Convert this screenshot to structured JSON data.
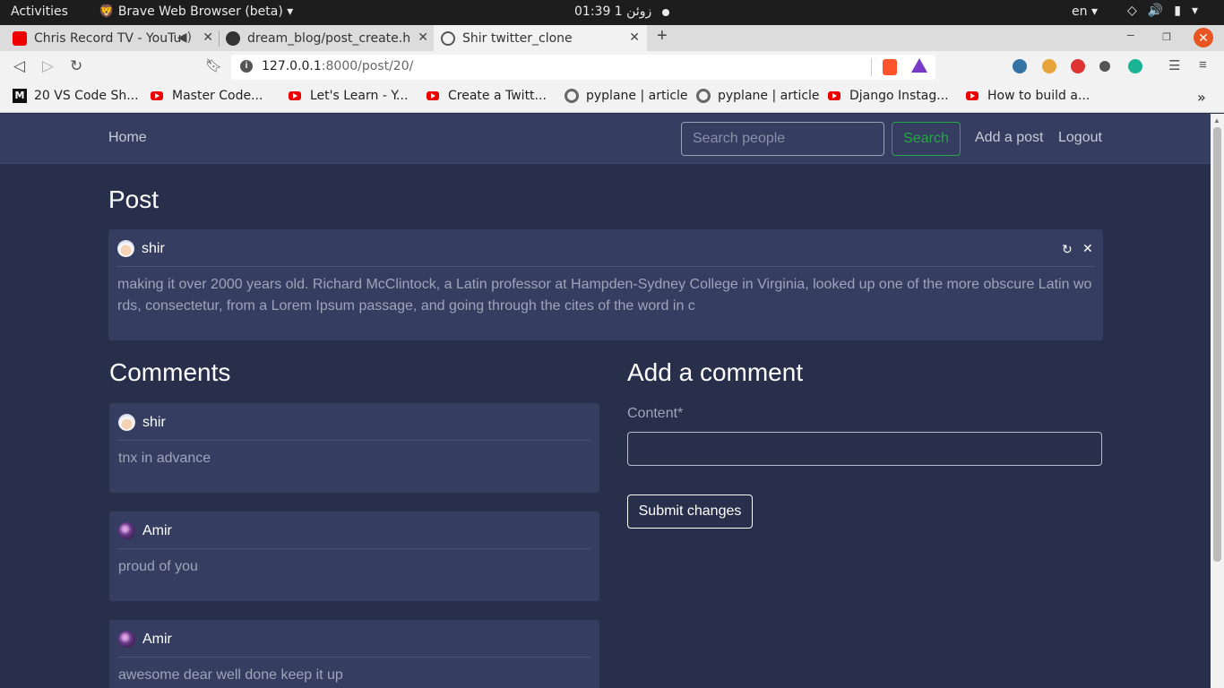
{
  "os_bar": {
    "activities": "Activities",
    "app_name": "Brave Web Browser (beta)",
    "clock": "01:39  زوئن 1",
    "language": "en"
  },
  "tabs": [
    {
      "title": "Chris Record TV - YouTu"
    },
    {
      "title": "dream_blog/post_create.h"
    },
    {
      "title": "Shir twitter_clone"
    }
  ],
  "toolbar": {
    "url_host": "127.0.0.1",
    "url_path": ":8000/post/20/"
  },
  "bookmarks": [
    {
      "label": "20 VS Code Sh..."
    },
    {
      "label": "Master Code..."
    },
    {
      "label": "Let's Learn - Y..."
    },
    {
      "label": "Create a Twitt..."
    },
    {
      "label": "pyplane | article"
    },
    {
      "label": "pyplane | article"
    },
    {
      "label": "Django Instag..."
    },
    {
      "label": "How to build a..."
    }
  ],
  "nav": {
    "home": "Home",
    "search_placeholder": "Search people",
    "search_button": "Search",
    "add_post": "Add a post",
    "logout": "Logout"
  },
  "post": {
    "heading": "Post",
    "author": "shir",
    "body_line1": "making it over 2000 years old. Richard McClintock, a Latin professor at Hampden-Sydney College in Virginia, looked up one of the more obscure Latin wo",
    "body_line2": "rds, consectetur, from a Lorem Ipsum passage, and going through the cites of the word in c"
  },
  "comments": {
    "heading": "Comments",
    "items": [
      {
        "author": "shir",
        "text": "tnx in advance"
      },
      {
        "author": "Amir",
        "text": "proud of you"
      },
      {
        "author": "Amir",
        "text": "awesome dear well done keep it up"
      }
    ]
  },
  "comment_form": {
    "heading": "Add a comment",
    "content_label": "Content*",
    "submit_label": "Submit changes"
  }
}
